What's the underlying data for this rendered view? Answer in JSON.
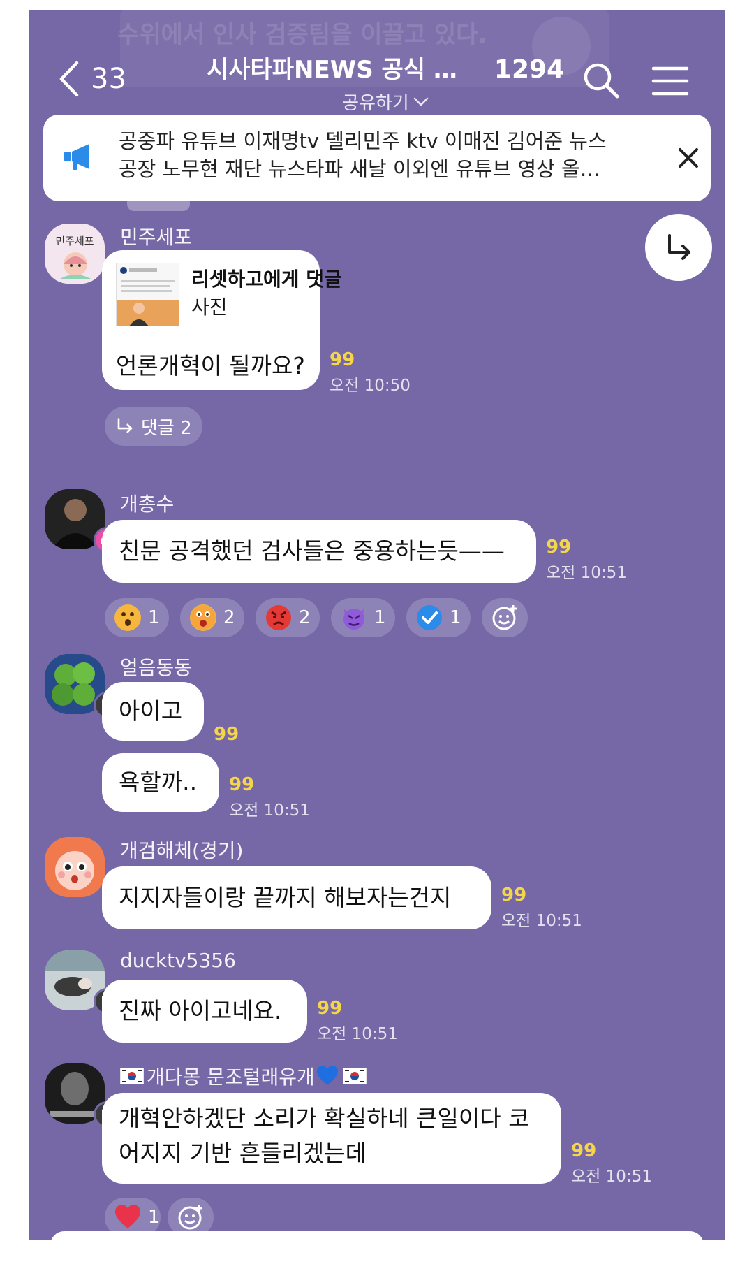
{
  "background_ghost": {
    "text": "수위에서 인사 검증팀을 이끌고 있다."
  },
  "header": {
    "back_count": "33",
    "room_title": "시사타파NEWS 공식 단…",
    "member_count": "1294",
    "share_label": "공유하기"
  },
  "notice": {
    "line1": "공중파 유튜브 이재명tv 델리민주 ktv 이매진 김어준 뉴스",
    "line2": "공장 노무현 재단 뉴스타파 새날 이외엔 유튜브 영상 올…"
  },
  "messages": [
    {
      "sender": "민주세포",
      "avatar_label": "민주세포",
      "link_title": "리셋하고에게 댓글",
      "link_subtitle": "사진",
      "text": "언론개혁이 될까요?",
      "unread": "99",
      "time": "오전 10:50",
      "reply_label": "댓글 2"
    },
    {
      "sender": "개총수",
      "text": "친문 공격했던 검사들은 중용하는듯——",
      "unread": "99",
      "time": "오전 10:51",
      "reactions": [
        {
          "icon": "surprised-face",
          "count": "1"
        },
        {
          "icon": "astonished-face",
          "count": "2"
        },
        {
          "icon": "angry-face",
          "count": "2"
        },
        {
          "icon": "devil-face",
          "count": "1"
        },
        {
          "icon": "check-mark",
          "count": "1"
        }
      ]
    },
    {
      "sender": "얼음동동",
      "text": "아이고",
      "unread": "99",
      "text2": "욕할까..",
      "unread2": "99",
      "time": "오전 10:51"
    },
    {
      "sender": "개검해체(경기)",
      "text": "지지자들이랑 끝까지 해보자는건지",
      "unread": "99",
      "time": "오전 10:51"
    },
    {
      "sender": "ducktv5356",
      "text": "진짜 아이고네요.",
      "unread": "99",
      "time": "오전 10:51"
    },
    {
      "sender": "개다몽 문조털래유개",
      "text_line1": "개혁안하겠단 소리가 확실하네 큰일이다 코",
      "text_line2": "어지지 기반 흔들리겠는데",
      "unread": "99",
      "time": "오전 10:51",
      "reactions": [
        {
          "icon": "heart",
          "count": "1"
        }
      ]
    }
  ],
  "colors": {
    "chat_background": "#7668a6",
    "unread": "#f5d64a",
    "notice_icon": "#2b8be8",
    "owner_badge": "#e94fa6",
    "heart": "#e8334a"
  }
}
